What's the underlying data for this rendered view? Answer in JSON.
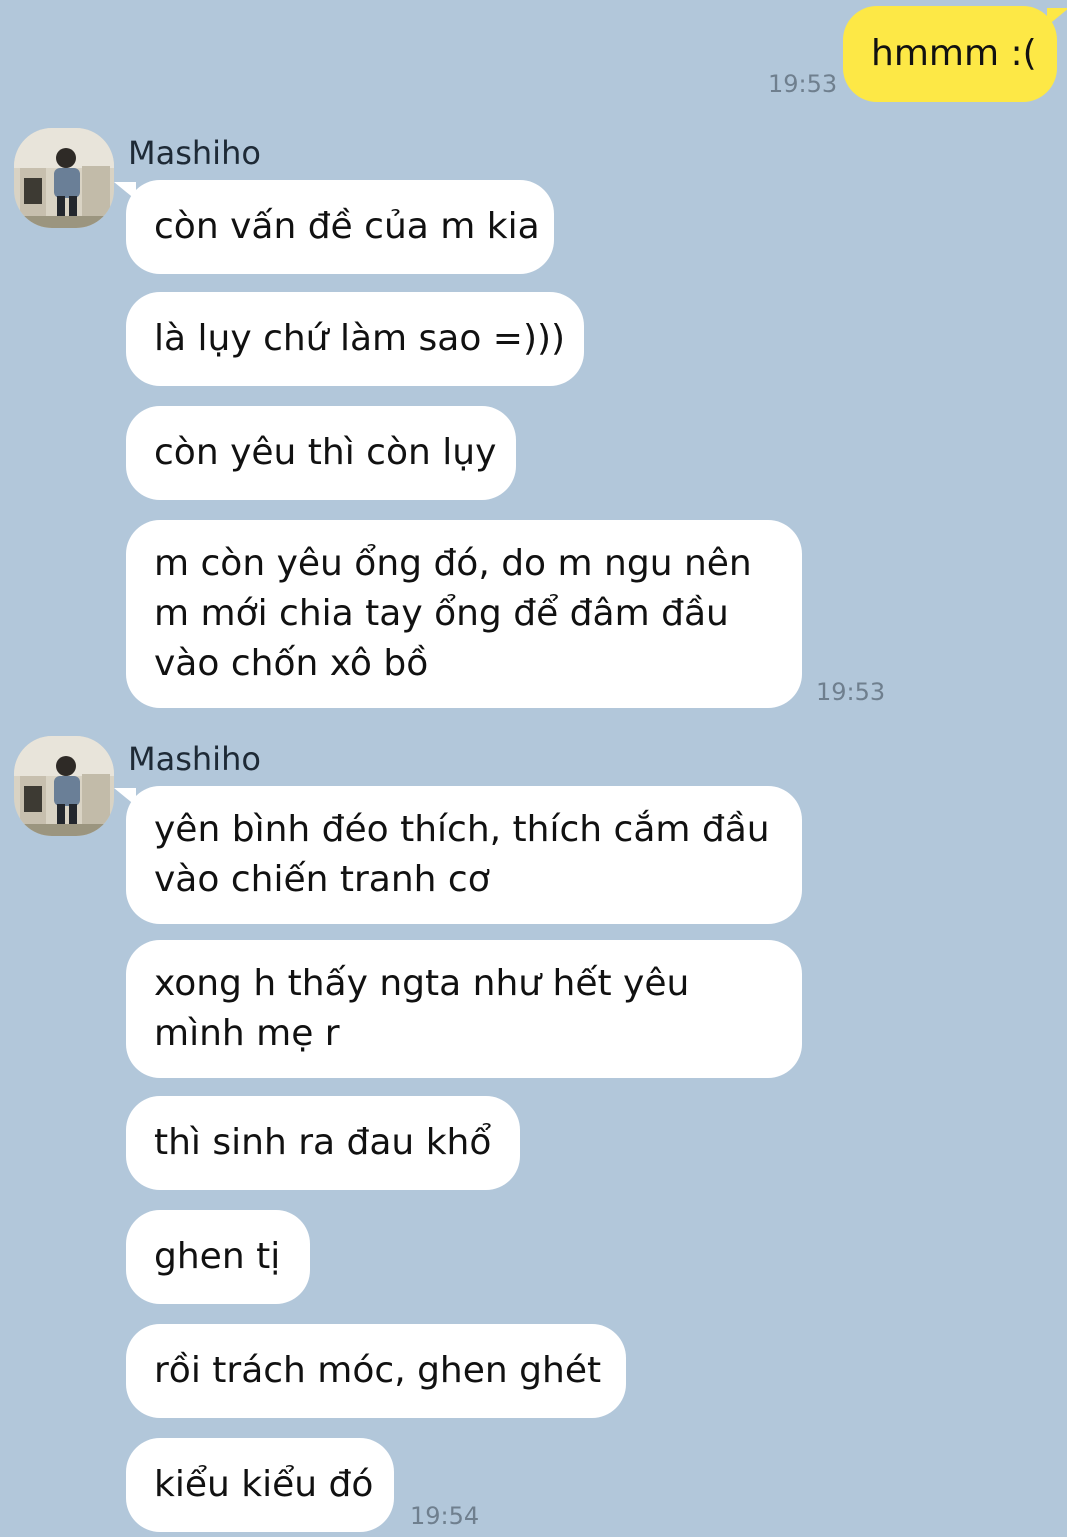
{
  "chat": {
    "outgoing": {
      "text": "hmmm :(",
      "time": "19:53"
    },
    "groups": [
      {
        "sender": "Mashiho",
        "messages": [
          "còn vấn đề của m kia",
          "là lụy chứ làm sao =)))",
          "còn yêu thì còn lụy",
          "m còn yêu ổng đó, do m ngu nên m mới chia tay ổng để đâm đầu vào chốn xô bồ"
        ],
        "time": "19:53"
      },
      {
        "sender": "Mashiho",
        "messages": [
          "yên bình đéo thích, thích cắm đầu vào chiến tranh cơ",
          "xong h thấy ngta như hết yêu mình mẹ r",
          "thì sinh ra đau khổ",
          "ghen tị",
          "rồi trách móc, ghen ghét",
          "kiểu kiểu đó"
        ],
        "time": "19:54"
      }
    ]
  },
  "colors": {
    "background": "#b2c7da",
    "incoming_bubble": "#ffffff",
    "outgoing_bubble": "#fde846",
    "timestamp": "#6f7f8e"
  },
  "icons": {
    "avatar": "sender-avatar-photo"
  }
}
